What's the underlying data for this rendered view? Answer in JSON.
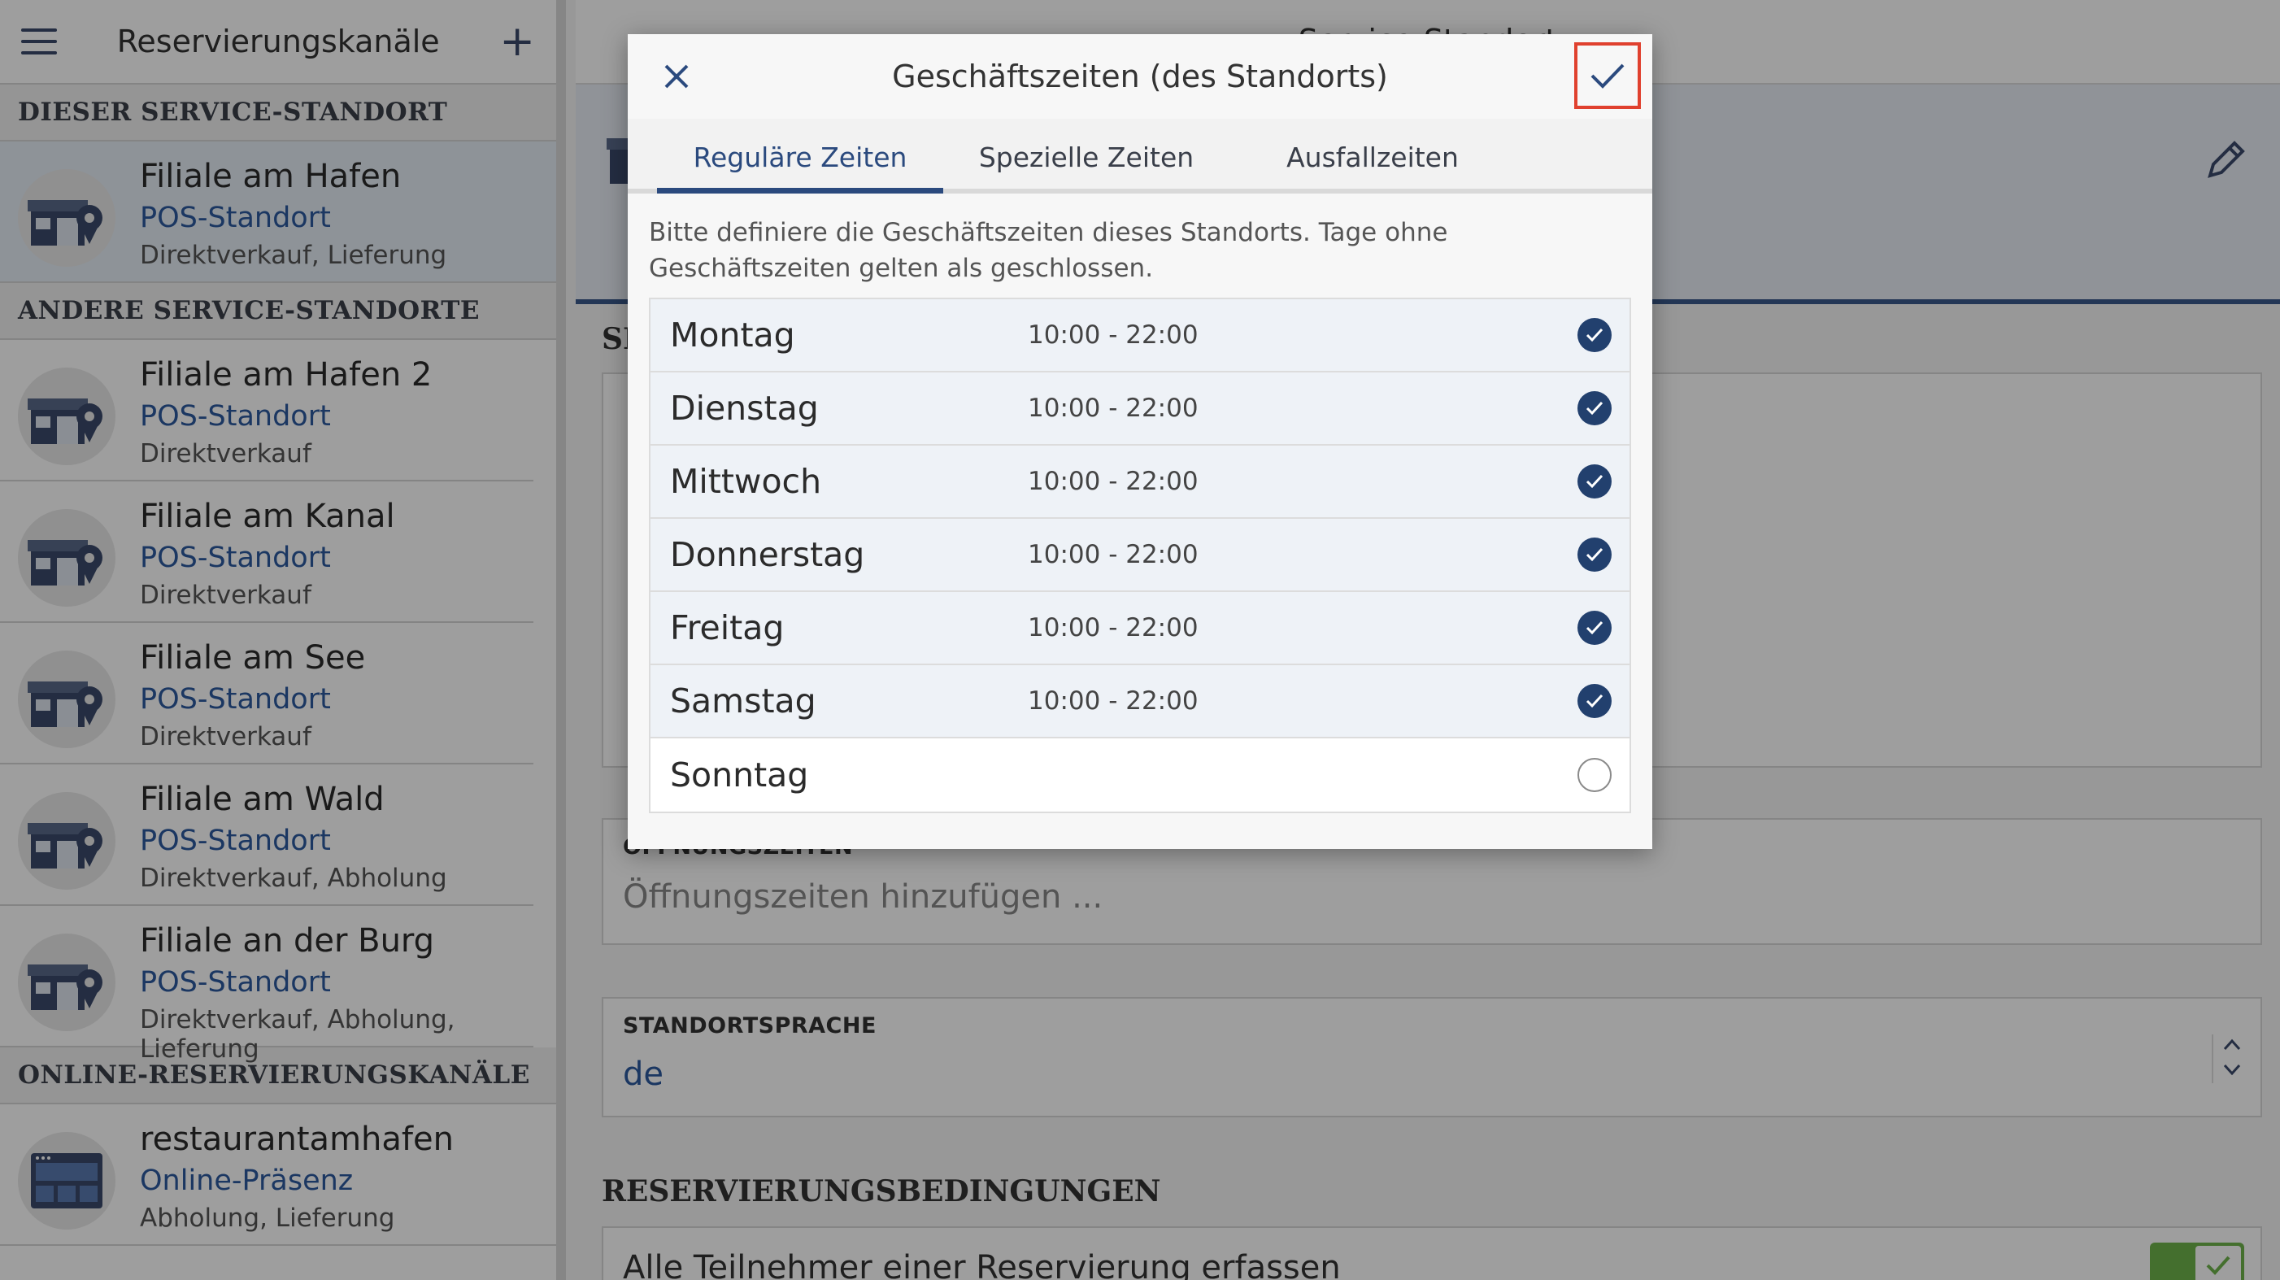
{
  "sidebar": {
    "title": "Reservierungskanäle",
    "sections": [
      {
        "label": "DIESER SERVICE-STANDORT"
      },
      {
        "label": "ANDERE SERVICE-STANDORTE"
      },
      {
        "label": "ONLINE-RESERVIERUNGSKANÄLE"
      }
    ],
    "current": {
      "name": "Filiale am Hafen",
      "kind": "POS-Standort",
      "features": "Direktverkauf, Lieferung"
    },
    "others": [
      {
        "name": "Filiale am Hafen 2",
        "kind": "POS-Standort",
        "features": "Direktverkauf"
      },
      {
        "name": "Filiale am Kanal",
        "kind": "POS-Standort",
        "features": "Direktverkauf"
      },
      {
        "name": "Filiale am See",
        "kind": "POS-Standort",
        "features": "Direktverkauf"
      },
      {
        "name": "Filiale am Wald",
        "kind": "POS-Standort",
        "features": "Direktverkauf, Abholung"
      },
      {
        "name": "Filiale an der Burg",
        "kind": "POS-Standort",
        "features": "Direktverkauf, Abholung, Lieferung"
      }
    ],
    "online": {
      "name": "restaurantamhafen",
      "kind": "Online-Präsenz",
      "features": "Abholung, Lieferung"
    }
  },
  "main": {
    "header_title": "Service-Standort",
    "section_short": "SE",
    "opening_hours": {
      "label": "ÖFFNUNGSZEITEN",
      "placeholder": "Öffnungszeiten hinzufügen ..."
    },
    "language": {
      "label": "STANDORTSPRACHE",
      "value": "de"
    },
    "reservation_conditions": {
      "title": "RESERVIERUNGSBEDINGUNGEN",
      "first_option": "Alle Teilnehmer einer Reservierung erfassen",
      "first_option_enabled": true
    }
  },
  "dialog": {
    "title": "Geschäftszeiten (des Standorts)",
    "tabs": [
      "Reguläre Zeiten",
      "Spezielle Zeiten",
      "Ausfallzeiten"
    ],
    "active_tab": "Reguläre Zeiten",
    "description": "Bitte definiere die Geschäftszeiten dieses Standorts. Tage ohne Geschäftszeiten gelten als geschlossen.",
    "days": [
      {
        "name": "Montag",
        "hours": "10:00 - 22:00",
        "open": true
      },
      {
        "name": "Dienstag",
        "hours": "10:00 - 22:00",
        "open": true
      },
      {
        "name": "Mittwoch",
        "hours": "10:00 - 22:00",
        "open": true
      },
      {
        "name": "Donnerstag",
        "hours": "10:00 - 22:00",
        "open": true
      },
      {
        "name": "Freitag",
        "hours": "10:00 - 22:00",
        "open": true
      },
      {
        "name": "Samstag",
        "hours": "10:00 - 22:00",
        "open": true
      },
      {
        "name": "Sonntag",
        "hours": "",
        "open": false
      }
    ]
  },
  "colors": {
    "accent": "#2b4a7e",
    "link": "#2d5a9e",
    "highlight_border": "#e0412f",
    "toggle_on": "#6fb34b"
  }
}
